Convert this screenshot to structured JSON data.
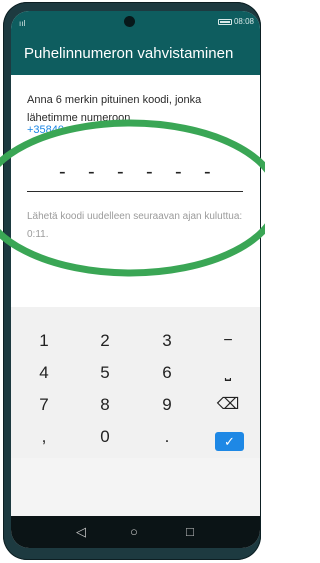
{
  "statusbar": {
    "signal": "ııl",
    "time": "08:08"
  },
  "appbar": {
    "title": "Puhelinnumeron vahvistaminen"
  },
  "content": {
    "instruction": "Anna 6 merkin pituinen koodi, jonka lähetimme numeroon",
    "phone_number": "+35840",
    "code_placeholder": [
      "-",
      "-",
      "-",
      "-",
      "-",
      "-"
    ],
    "resend_text": "Lähetä koodi uudelleen seuraavan ajan kuluttua: 0:11."
  },
  "keypad": {
    "keys": [
      "1",
      "2",
      "3",
      "−",
      "4",
      "5",
      "6",
      "⎵",
      "7",
      "8",
      "9",
      "⌫",
      ",",
      "0",
      ".",
      "✓"
    ]
  },
  "navbar": {
    "back": "◁",
    "home": "○",
    "recent": "□"
  },
  "colors": {
    "appbar": "#0e5d5f",
    "accent": "#1e88e5",
    "annotation": "#3aa655"
  }
}
